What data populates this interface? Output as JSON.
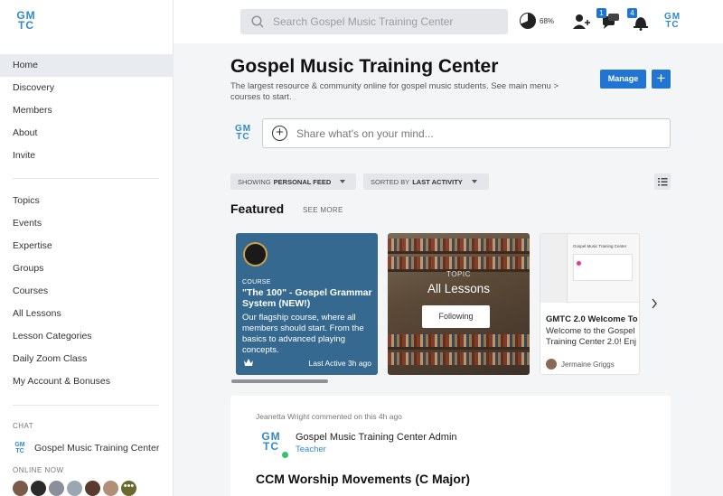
{
  "app": {
    "logo_text_top": "GM",
    "logo_text_bottom": "TC"
  },
  "sidebar": {
    "items_primary": [
      {
        "label": "Home",
        "active": true
      },
      {
        "label": "Discovery"
      },
      {
        "label": "Members"
      },
      {
        "label": "About"
      },
      {
        "label": "Invite"
      }
    ],
    "items_secondary": [
      {
        "label": "Topics"
      },
      {
        "label": "Events"
      },
      {
        "label": "Expertise"
      },
      {
        "label": "Groups"
      },
      {
        "label": "Courses"
      },
      {
        "label": "All Lessons"
      },
      {
        "label": "Lesson Categories"
      },
      {
        "label": "Daily Zoom Class"
      },
      {
        "label": "My Account & Bonuses"
      }
    ],
    "chat_label": "CHAT",
    "chat_item": "Gospel Music Training Center",
    "online_label": "ONLINE NOW",
    "online_more": "•••"
  },
  "header": {
    "search_placeholder": "Search Gospel Music Training Center",
    "progress_text": "68%",
    "progress_value": 0.68,
    "messages_badge": "1",
    "notifications_badge": "4"
  },
  "main": {
    "title": "Gospel Music Training Center",
    "subtitle": "The largest resource & community online for gospel music students. See main menu > courses to start.",
    "manage_label": "Manage",
    "add_label": "+",
    "post_placeholder": "Share what's on your mind...",
    "filter_feed_prefix": "SHOWING",
    "filter_feed_value": "PERSONAL FEED",
    "filter_sort_prefix": "SORTED BY",
    "filter_sort_value": "LAST ACTIVITY",
    "featured_heading": "Featured",
    "see_more": "SEE MORE"
  },
  "cards": {
    "course": {
      "type": "COURSE",
      "title": "\"The 100\" - Gospel Grammar System (NEW!)",
      "description": "Our flagship course, where all members should start. From the basics to advanced playing concepts.",
      "activity": "Last Active 3h ago"
    },
    "topic": {
      "type": "TOPIC",
      "title": "All Lessons",
      "button": "Following"
    },
    "post": {
      "mock_title": "Gospel Music Training Center",
      "title": "GMTC 2.0 Welcome To",
      "description_1": "Welcome to the Gospel",
      "description_2": "Training Center 2.0! Enj",
      "author": "Jermaine Griggs"
    }
  },
  "feed": {
    "meta": "Jeanetta Wright commented on this 4h ago",
    "author_name": "Gospel Music Training Center Admin",
    "author_role": "Teacher",
    "post_title": "CCM Worship Movements (C Major)"
  },
  "colors": {
    "accent": "#1f75d1",
    "brand": "#2e8bc9",
    "course_card": "#35698f"
  }
}
